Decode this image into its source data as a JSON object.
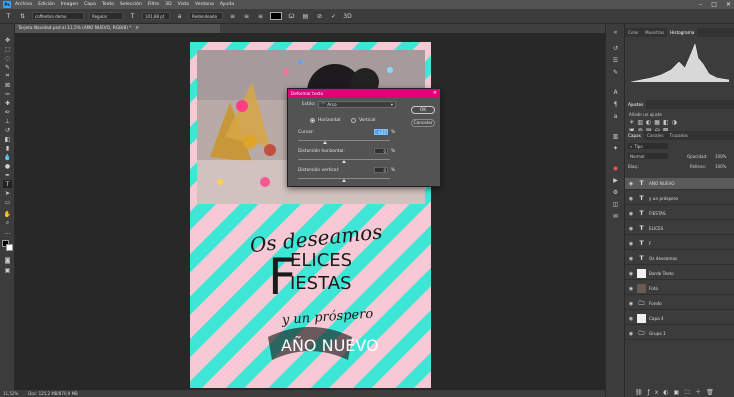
{
  "menubar": {
    "logo": "Ps",
    "items": [
      "Archivo",
      "Edición",
      "Imagen",
      "Capa",
      "Texto",
      "Selección",
      "Filtro",
      "3D",
      "Vista",
      "Ventana",
      "Ayuda"
    ]
  },
  "optbar": {
    "font_family": "coffeetea demo",
    "font_style": "Regular",
    "font_size": "101,88 pt",
    "antialias": "Redondeado",
    "text_color": "#000000"
  },
  "document": {
    "tab_title": "Tarjeta Navidad.psd al 11,5% (AÑO NUEVO, RGB/8) *",
    "text_line1": "Os deseamos",
    "text_line2": "ELICES",
    "text_line3": "IESTAS",
    "text_dropcap": "F",
    "text_line4": "y un próspero",
    "text_line5": "AÑO NUEVO",
    "colors": {
      "pink": "#f6c9d4",
      "cyan": "#3ee6d6",
      "banner": "#2b2b2b",
      "banner_fill": "#7a1f2b"
    }
  },
  "statusbar": {
    "zoom": "11,52%",
    "doc": "Doc: 125,2 MB/870,9 MB"
  },
  "dialog": {
    "title": "Deformar texto",
    "style_label": "Estilo:",
    "style_value": "Arco",
    "orientation": {
      "horizontal": "Horizontal",
      "vertical": "Vertical",
      "selected": "horizontal"
    },
    "curve_label": "Curvar:",
    "curve_value": "+27",
    "hdist_label": "Distorsión horizontal:",
    "hdist_value": "0",
    "vdist_label": "Distorsión vertical:",
    "vdist_value": "0",
    "percent": "%",
    "ok_label": "OK",
    "cancel_label": "Cancelar"
  },
  "panels": {
    "top_tabs": [
      "Color",
      "Muestras",
      "Histograma"
    ],
    "adjust_tab": "Ajustes",
    "adjust_hint": "Añadir un ajuste",
    "layer_tabs": [
      "Capas",
      "Canales",
      "Trazados"
    ],
    "kind_label": "Tipo",
    "blend_mode": "Normal",
    "opacity_label": "Opacidad:",
    "opacity_value": "100%",
    "lock_label": "Bloq.:",
    "fill_label": "Relleno:",
    "fill_value": "100%",
    "layers": [
      {
        "name": "AÑO NUEVO",
        "kind": "text",
        "selected": true
      },
      {
        "name": "y un próspero",
        "kind": "text"
      },
      {
        "name": "FIESTAS",
        "kind": "text"
      },
      {
        "name": "ELICES",
        "kind": "text"
      },
      {
        "name": "F",
        "kind": "text"
      },
      {
        "name": "Os deseamos",
        "kind": "text"
      },
      {
        "name": "Borde Texto",
        "kind": "white"
      },
      {
        "name": "Foto",
        "kind": "photo"
      },
      {
        "name": "Fondo",
        "kind": "folder"
      },
      {
        "name": "Capa 4",
        "kind": "white"
      },
      {
        "name": "Grupo 1",
        "kind": "folder"
      }
    ]
  }
}
